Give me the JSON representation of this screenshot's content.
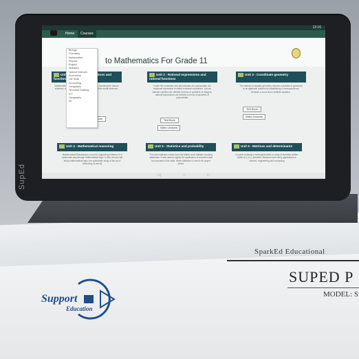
{
  "screen": {
    "status_text": "12:16",
    "nav": {
      "home": "Home",
      "courses": "Courses"
    },
    "title": "Mathematics For Grade 11",
    "dropdown_items": [
      "Biology",
      "Chemistry",
      "Mathematics",
      "Physics",
      "English",
      "Afrikaans",
      "Natural Sciences",
      "Economics",
      "Life Skills",
      "Accounting",
      "Geography",
      "Technical Drawing",
      "ICT",
      "Geography",
      "All"
    ],
    "units": [
      {
        "num": "1",
        "title": "Unit 1 - Exponents, equations and functions",
        "body": "Mathematics is the foundation of many fields, including the natural sciences, engineering, medicine, finance and the social sciences.",
        "buttons": [
          "Text Book",
          "Video Lessons"
        ]
      },
      {
        "num": "2",
        "title": "Unit 2 - Rational expressions and rational functions",
        "body": "If both the numerator and denominator are polynomials, the fractional expression is called a rational expression. Just as rational numbers are defined in terms of quotients of integers, rational expressions are defined in terms of quotients of polynomials.",
        "buttons": [
          "Text Book",
          "Video Lessons"
        ]
      },
      {
        "num": "3",
        "title": "Unit 3 - Coordinate geometry",
        "body": "The method of analytic geometry reduces a problem in geometry to an algebraic problem by establishing a correspondence between a curve and a definite equation.",
        "buttons": [
          "Text Book",
          "Video Lessons"
        ]
      },
      {
        "num": "4",
        "title": "Unit 4 - Mathematical reasoning",
        "body": "Mathematical Reasoning is a tool for organizing evidence in a systematic way through mathematical logic. In this unit you will study mathematical logic, the systematic study of the art of reasoning, its arrival",
        "buttons": []
      },
      {
        "num": "5",
        "title": "Unit 5 - Statistics and probability",
        "body": "The word statistics comes from the Italian word 'statista' meaning statesman. It was used to signify the application of recorded data for purposes of the state. When statistics is used in its proper sense",
        "buttons": []
      },
      {
        "num": "6",
        "title": "Unit 6 - Matrices and determinants",
        "body": "A matrix is simply a rectangular table or array of numbers written within a [ ] or ( ) brackets. Matrices have many applications in science, engineering and computing",
        "buttons": []
      }
    ]
  },
  "tablet": {
    "brand": "SupEd"
  },
  "box": {
    "brand": "SparkEd Educational",
    "product": "SUPED P",
    "model": "MODEL: SE"
  },
  "logo": {
    "line1": "Support",
    "line2": "Education"
  },
  "colors": {
    "appbar": "#2d5c4e",
    "card_head": "#1f4f59",
    "logo": "#1e4f8a"
  }
}
